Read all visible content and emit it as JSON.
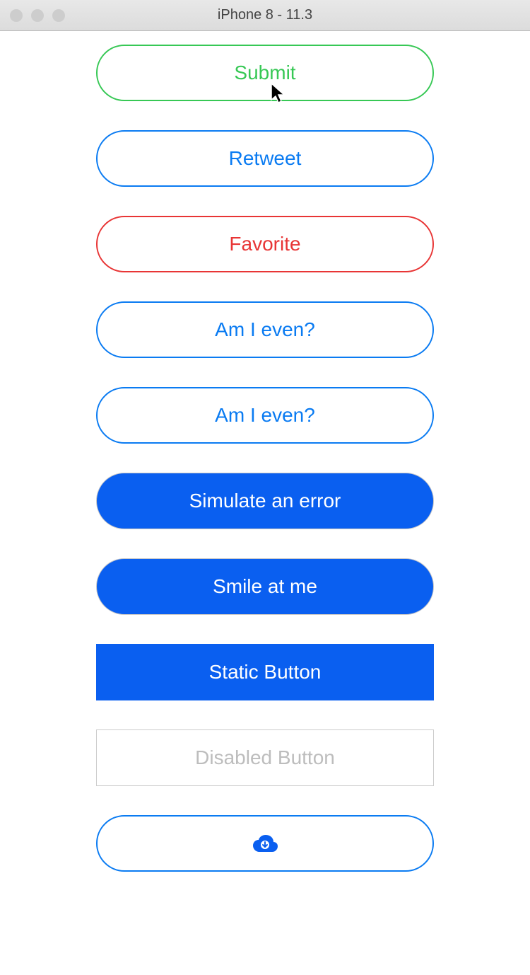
{
  "window": {
    "title": "iPhone 8 - 11.3"
  },
  "buttons": {
    "submit": "Submit",
    "retweet": "Retweet",
    "favorite": "Favorite",
    "am_i_even_1": "Am I even?",
    "am_i_even_2": "Am I even?",
    "simulate_error": "Simulate an error",
    "smile": "Smile at me",
    "static": "Static Button",
    "disabled": "Disabled Button"
  },
  "colors": {
    "green": "#37c855",
    "blue_outline": "#0a7bf2",
    "red": "#e83535",
    "blue_solid": "#0a5ff0",
    "disabled_text": "#bdbdbd",
    "disabled_border": "#cccccc"
  }
}
